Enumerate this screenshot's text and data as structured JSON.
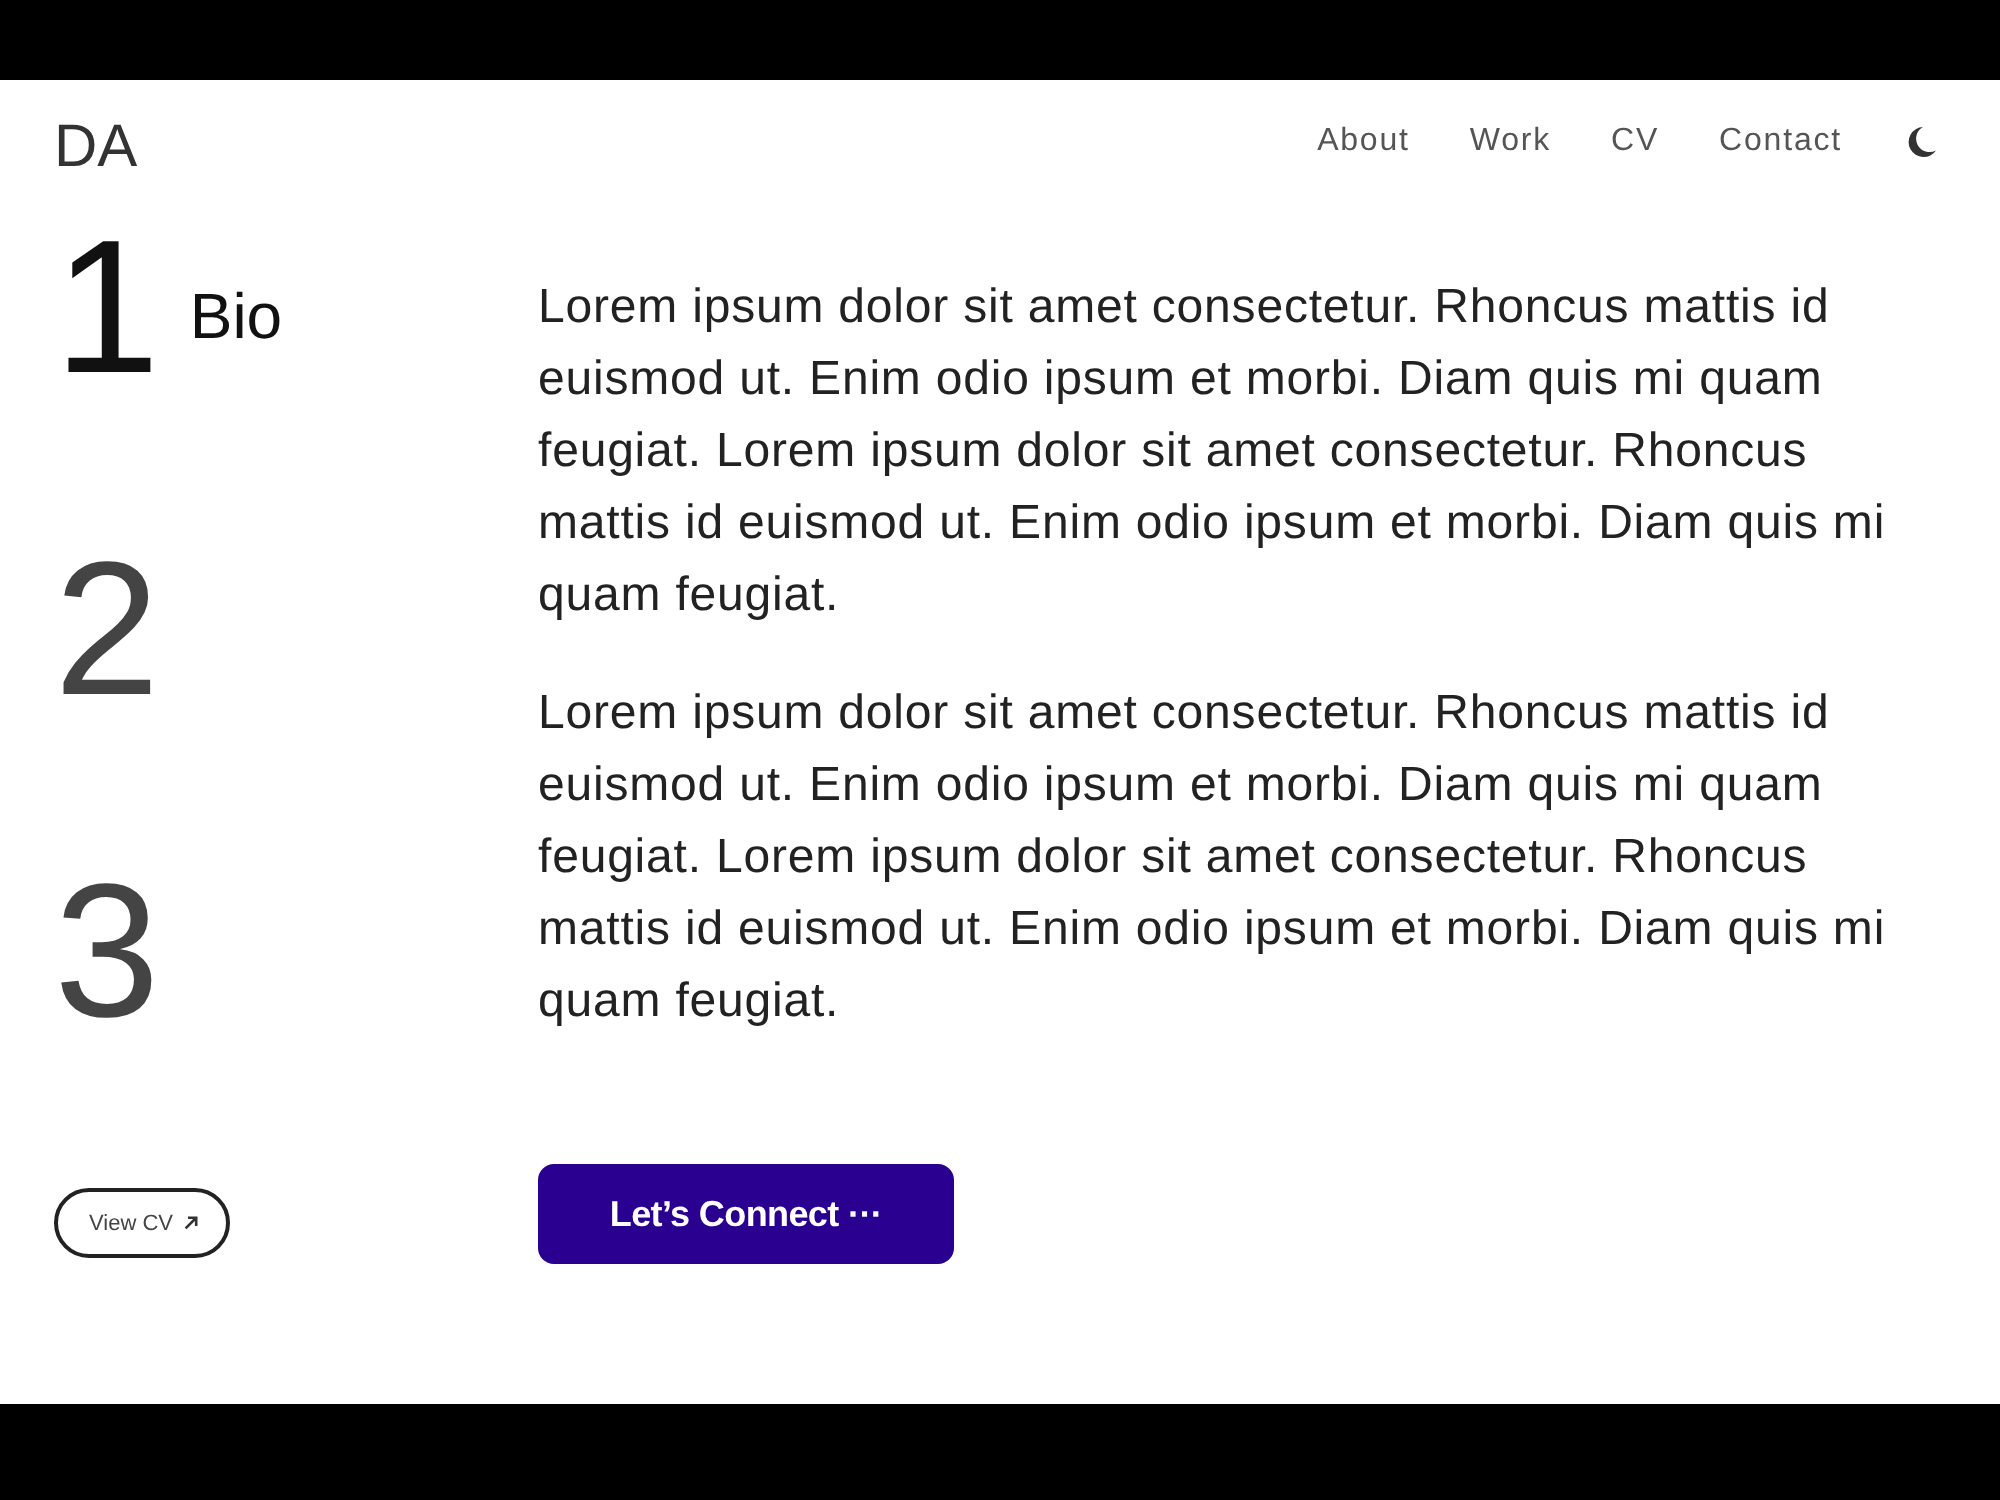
{
  "header": {
    "logo": "DA",
    "nav": [
      {
        "label": "About"
      },
      {
        "label": "Work"
      },
      {
        "label": "CV"
      },
      {
        "label": "Contact"
      }
    ]
  },
  "sections": [
    {
      "number": "1",
      "title": "Bio",
      "selected": true
    },
    {
      "number": "2",
      "selected": false
    },
    {
      "number": "3",
      "selected": false
    }
  ],
  "paragraphs": [
    "Lorem ipsum dolor sit amet consectetur. Rhoncus mattis id euismod ut. Enim odio ipsum et morbi. Diam quis mi quam feugiat. Lorem ipsum dolor sit amet consectetur. Rhoncus mattis id euismod ut. Enim odio ipsum et morbi. Diam quis mi quam feugiat.",
    "Lorem ipsum dolor sit amet consectetur. Rhoncus mattis id euismod ut. Enim odio ipsum et morbi. Diam quis mi quam feugiat. Lorem ipsum dolor sit amet consectetur. Rhoncus mattis id euismod ut. Enim odio ipsum et morbi. Diam quis mi quam feugiat."
  ],
  "actions": [
    {
      "kind": "outline",
      "label": "View CV"
    },
    {
      "kind": "primary",
      "label": "Let’s Connect ···"
    }
  ]
}
